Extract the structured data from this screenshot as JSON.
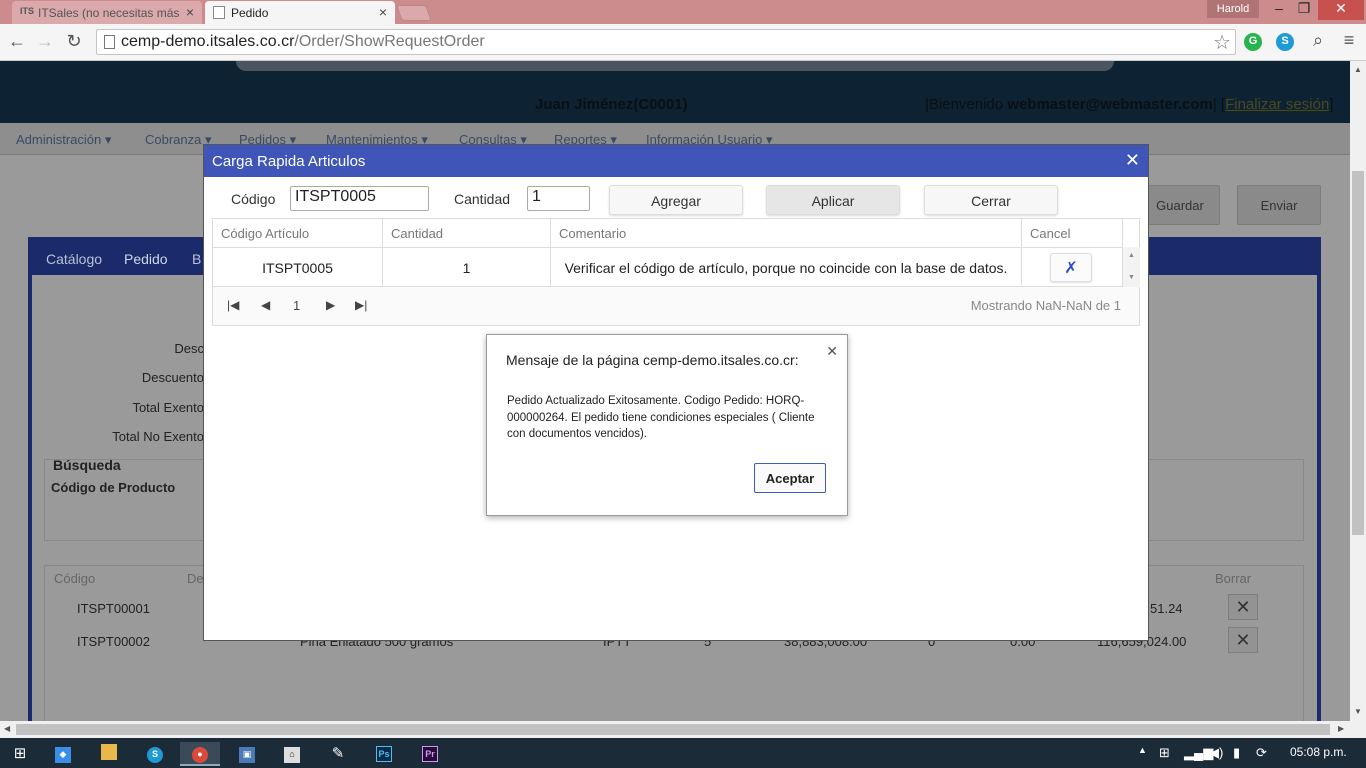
{
  "browser": {
    "tabs": [
      {
        "title": "ITSales (no necesitas más",
        "icon": "ITS"
      },
      {
        "title": "Pedido"
      }
    ],
    "profile": "Harold",
    "url_host": "cemp-demo.itsales.co.cr",
    "url_path": "/Order/ShowRequestOrder"
  },
  "header": {
    "user": "Juan Jiménez(C0001)",
    "welcome_prefix": "|Bienvenido ",
    "welcome_user": "webmaster@webmaster.com",
    "welcome_sep": "| [",
    "logout": "Finalizar sesión",
    "welcome_end": "]"
  },
  "menu": [
    "Administración ▾",
    "Cobranza ▾",
    "Pedidos ▾",
    "Mantenimientos ▾",
    "Consultas ▾",
    "Reportes ▾",
    "Información Usuario ▾"
  ],
  "background": {
    "buttons": {
      "guardar": "Guardar",
      "enviar": "Enviar"
    },
    "tabs": [
      "Catálogo",
      "Pedido",
      "B"
    ],
    "labels": [
      "Desc",
      "Descuento",
      "Total Exento",
      "Total No Exento"
    ],
    "search_title": "Búsqueda",
    "search_label": "Código de Producto",
    "table_headers": [
      "Código",
      "De",
      "Borrar"
    ],
    "rows": [
      {
        "code": "ITSPT00001",
        "desc": "",
        "unit": "",
        "qty": "",
        "price": "",
        "disc": "",
        "tax": "",
        "total": "51.24"
      },
      {
        "code": "ITSPT00002",
        "desc": "Piña Enlatado 500 gramos",
        "unit": "IPTT",
        "qty": "5",
        "price": "38,883,008.00",
        "disc": "0",
        "tax": "0.00",
        "total": "116,659,024.00"
      }
    ]
  },
  "modal": {
    "title": "Carga Rapida Articulos",
    "codigo_label": "Código",
    "codigo_value": "ITSPT0005",
    "cantidad_label": "Cantidad",
    "cantidad_value": "1",
    "buttons": {
      "agregar": "Agregar",
      "aplicar": "Aplicar",
      "cerrar": "Cerrar"
    },
    "grid_headers": [
      "Código Artículo",
      "Cantidad",
      "Comentario",
      "Cancel"
    ],
    "grid_rows": [
      {
        "codigo": "ITSPT0005",
        "cantidad": "1",
        "comentario": "Verificar el código de artículo, porque no coincide con la base de datos.",
        "cancel": "✗"
      }
    ],
    "pager": {
      "page": "1",
      "info": "Mostrando NaN-NaN de 1"
    }
  },
  "alert": {
    "title": "Mensaje de la página cemp-demo.itsales.co.cr:",
    "message": "Pedido Actualizado Exitosamente. Codigo Pedido: HORQ-000000264. El pedido tiene condiciones especiales ( Cliente con documentos vencidos).",
    "ok": "Aceptar"
  },
  "taskbar": {
    "clock": "05:08 p.m."
  }
}
